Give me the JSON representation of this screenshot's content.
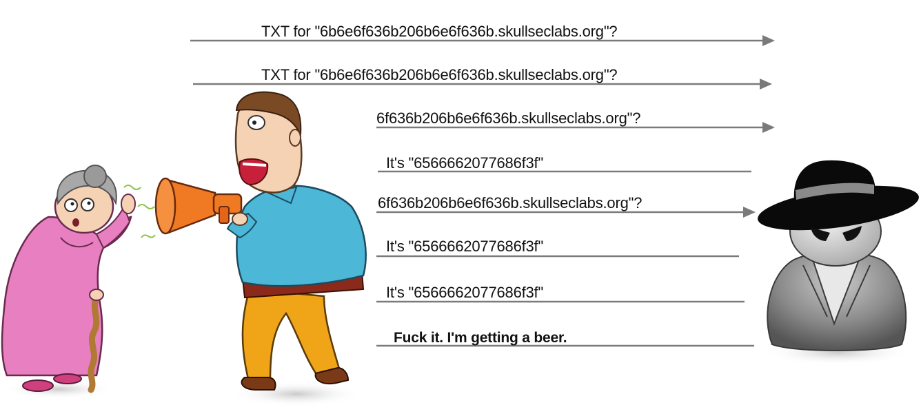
{
  "messages": [
    {
      "text": "TXT for \"6b6e6f636b206b6e6f636b.skullseclabs.org\"?",
      "direction": "right"
    },
    {
      "text": "TXT for \"6b6e6f636b206b6e6f636b.skullseclabs.org\"?",
      "direction": "right"
    },
    {
      "text": "6f636b206b6e6f636b.skullseclabs.org\"?",
      "direction": "right"
    },
    {
      "text": "It's \"6566662077686f3f\"",
      "direction": "left"
    },
    {
      "text": "6f636b206b6e6f636b.skullseclabs.org\"?",
      "direction": "right"
    },
    {
      "text": "It's \"6566662077686f3f\"",
      "direction": "left"
    },
    {
      "text": "It's \"6566662077686f3f\"",
      "direction": "left"
    },
    {
      "text": "Fuck it. I'm getting a beer.",
      "direction": "left"
    }
  ],
  "figures": {
    "grandma": "hard-of-hearing-grandma-illustration",
    "man": "man-shouting-into-megaphone-illustration",
    "spy": "spy-in-black-hat-icon"
  },
  "colors": {
    "arrow": "#7a7a7a",
    "text": "#111111",
    "megaphone": "#f07a23",
    "shirt": "#4cb7d6",
    "pants": "#f0a418",
    "dress": "#e77fc0",
    "hat": "#0a0a0a"
  }
}
